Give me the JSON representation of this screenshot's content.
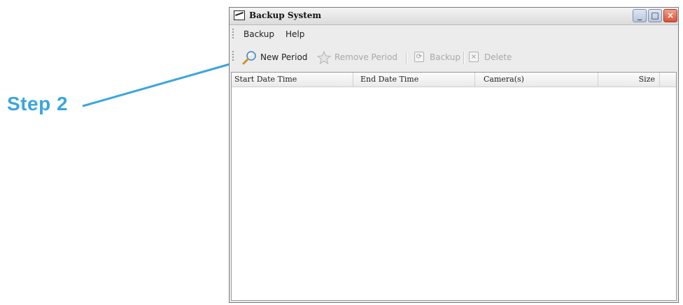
{
  "callout": {
    "label": "Step 2",
    "color": "#3aa6dc"
  },
  "window": {
    "title": "Backup System",
    "controls": {
      "minimize": "_",
      "maximize": "□",
      "close": "×"
    }
  },
  "menu": {
    "items": [
      {
        "label": "Backup"
      },
      {
        "label": "Help"
      }
    ]
  },
  "toolbar": {
    "new_period": "New Period",
    "remove_period": "Remove Period",
    "backup": "Backup",
    "delete": "Delete"
  },
  "list": {
    "columns": [
      "Start Date Time",
      "End Date Time",
      "Camera(s)",
      "Size"
    ],
    "rows": []
  }
}
